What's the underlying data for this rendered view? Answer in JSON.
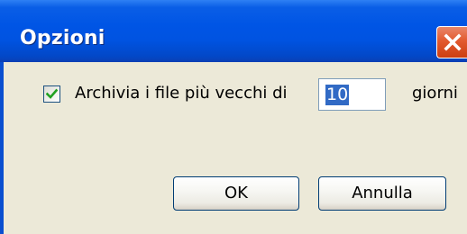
{
  "dialog": {
    "title": "Opzioni",
    "close_icon": "close-icon",
    "accent_color": "#0055e5",
    "close_color": "#e25a2f"
  },
  "options": {
    "archive_checkbox": {
      "checked": true,
      "label": "Archivia i file più vecchi di"
    },
    "days_input": {
      "value": "10",
      "selected": true
    },
    "unit_label": "giorni"
  },
  "buttons": {
    "ok_label": "OK",
    "cancel_label": "Annulla"
  }
}
